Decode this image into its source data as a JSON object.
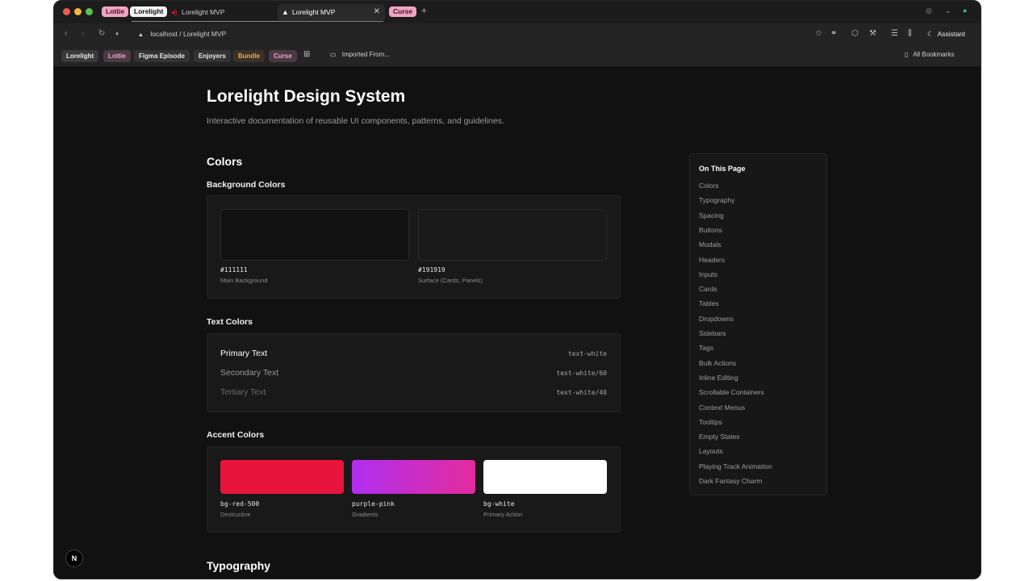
{
  "tabstrip": {
    "pinned": [
      "Lottie",
      "Lorelight"
    ],
    "tabs": [
      {
        "title": "Lorelight MVP"
      },
      {
        "title": "Lorelight MVP"
      }
    ],
    "extra_pill": "Curse",
    "new_tab": "+"
  },
  "toolbar": {
    "back": "‹",
    "forward": "›",
    "reload": "↻",
    "mic": "♦",
    "url": "localhost / Lorelight MVP",
    "assistant": "Assistant"
  },
  "bookmarks": {
    "items": [
      "Lorelight",
      "Lottie",
      "Figma Episode",
      "Enjoyers",
      "Bundle",
      "Curse"
    ],
    "folder": "Imported From...",
    "all": "All Bookmarks"
  },
  "page": {
    "title": "Lorelight Design System",
    "subtitle": "Interactive documentation of reusable UI components, patterns, and guidelines.",
    "sections": {
      "colors": "Colors",
      "typography": "Typography"
    },
    "background_colors": {
      "title": "Background Colors",
      "swatches": [
        {
          "color": "#111111",
          "code": "#111111",
          "desc": "Main Background"
        },
        {
          "color": "#191919",
          "code": "#191919",
          "desc": "Surface (Cards, Panels)"
        }
      ]
    },
    "text_colors": {
      "title": "Text Colors",
      "rows": [
        {
          "name": "Primary Text",
          "code": "text-white",
          "color": "#ffffff"
        },
        {
          "name": "Secondary Text",
          "code": "text-white/60",
          "color": "#9a9a9a"
        },
        {
          "name": "Tertiary Text",
          "code": "text-white/40",
          "color": "#6a6a6a"
        }
      ]
    },
    "accent_colors": {
      "title": "Accent Colors",
      "swatches": [
        {
          "code": "bg-red-500",
          "desc": "Destructive",
          "color": "#e8143c"
        },
        {
          "code": "purple-pink",
          "desc": "Gradients",
          "color": "#b02ef0",
          "color2": "#e32c9c"
        },
        {
          "code": "bg-white",
          "desc": "Primary Action",
          "color": "#ffffff"
        }
      ]
    }
  },
  "toc": {
    "title": "On This Page",
    "items": [
      "Colors",
      "Typography",
      "Spacing",
      "Buttons",
      "Modals",
      "Headers",
      "Inputs",
      "Cards",
      "Tables",
      "Dropdowns",
      "Sidebars",
      "Tags",
      "Bulk Actions",
      "Inline Editing",
      "Scrollable Containers",
      "Context Menus",
      "Tooltips",
      "Empty States",
      "Layouts",
      "Playing Track Animation",
      "Dark Fantasy Charm"
    ]
  },
  "badge": "N",
  "colors": {
    "accent_pink": "#f2a3c2",
    "bookmark_orange": "#f0a742"
  }
}
